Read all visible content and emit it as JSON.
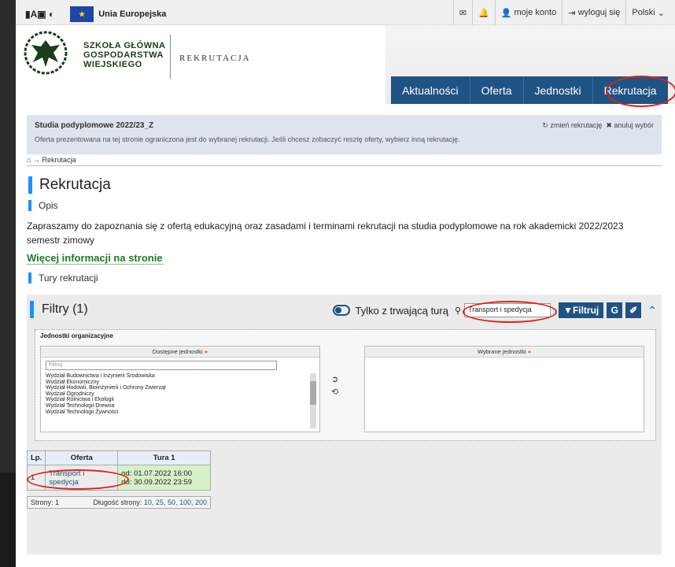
{
  "topbar": {
    "access_icons": "▮A▣ ◐",
    "eu_label": "Unia Europejska",
    "account": "moje konto",
    "logout": "wyloguj się",
    "language": "Polski"
  },
  "logo": {
    "year": "1816",
    "line1": "SZKOŁA GŁÓWNA",
    "line2": "GOSPODARSTWA",
    "line3": "WIEJSKIEGO",
    "abbr": "SGGW",
    "section": "REKRUTACJA"
  },
  "nav": [
    "Aktualności",
    "Oferta",
    "Jednostki",
    "Rekrutacja"
  ],
  "info": {
    "title": "Studia podyplomowe 2022/23_Z",
    "subtitle": "Oferta prezentowana na tej stronie ograniczona jest do wybranej rekrutacji. Jeśli chcesz zobaczyć resztę oferty, wybierz inną rekrutację.",
    "change": "zmień rekrutację",
    "cancel": "anuluj wybór"
  },
  "breadcrumb": "Rekrutacja",
  "page_title": "Rekrutacja",
  "section_desc": "Opis",
  "description": "Zapraszamy do zapoznania się z ofertą edukacyjną oraz zasadami i terminami rekrutacji na studia podyplomowe na rok akademicki 2022/2023 semestr zimowy",
  "more_link": "Więcej informacji na stronie",
  "section_rounds": "Tury rekrutacji",
  "filters": {
    "title": "Filtry (1)",
    "toggle_label": "Tylko z trwającą turą",
    "search_value": "Transport i spedycja",
    "filter_button": "Filtruj",
    "g_button": "G",
    "units_title": "Jednostki organizacyjne",
    "available_header": "Dostępne jednostki",
    "selected_header": "Wybrane jednostki",
    "filter_placeholder": "Filtruj",
    "units": [
      "Wydział Budownictwa i Inżynierii Środowiska",
      "Wydział Ekonomiczny",
      "Wydział Hodowli, Bioinżynierii i Ochrony Zwierząt",
      "Wydział Ogrodniczy",
      "Wydział Rolnictwa i Ekologii",
      "Wydział Technologii Drewna",
      "Wydział Technologii Żywności"
    ]
  },
  "table": {
    "headers": [
      "Lp.",
      "Oferta",
      "Tura 1"
    ],
    "row": {
      "lp": "1",
      "offer": "Transport i spedycja",
      "from": "od: 01.07.2022 16:00",
      "to": "do: 30.09.2022 23:59"
    },
    "pages_label": "Strony: 1",
    "page_length_label": "Długość strony:",
    "page_sizes": "10, 25, 50, 100, 200"
  },
  "colors": {
    "nav": "#1f5383",
    "accent": "#1e90ff",
    "highlight": "#e0221b",
    "link_green": "#1f7a23"
  }
}
